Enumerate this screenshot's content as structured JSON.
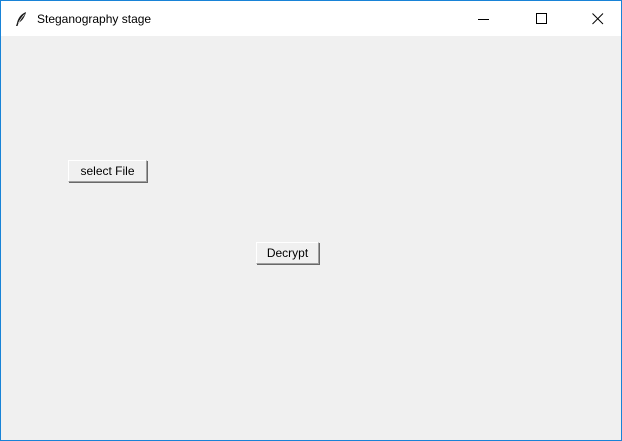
{
  "window": {
    "title": "Steganography stage",
    "app_icon": "feather-icon",
    "controls": [
      "minimize-icon",
      "maximize-icon",
      "close-icon"
    ],
    "accent_border_color": "#1883d7",
    "background_color": "#f0f0f0"
  },
  "buttons": {
    "select_file_label": "select File",
    "decrypt_label": "Decrypt"
  }
}
